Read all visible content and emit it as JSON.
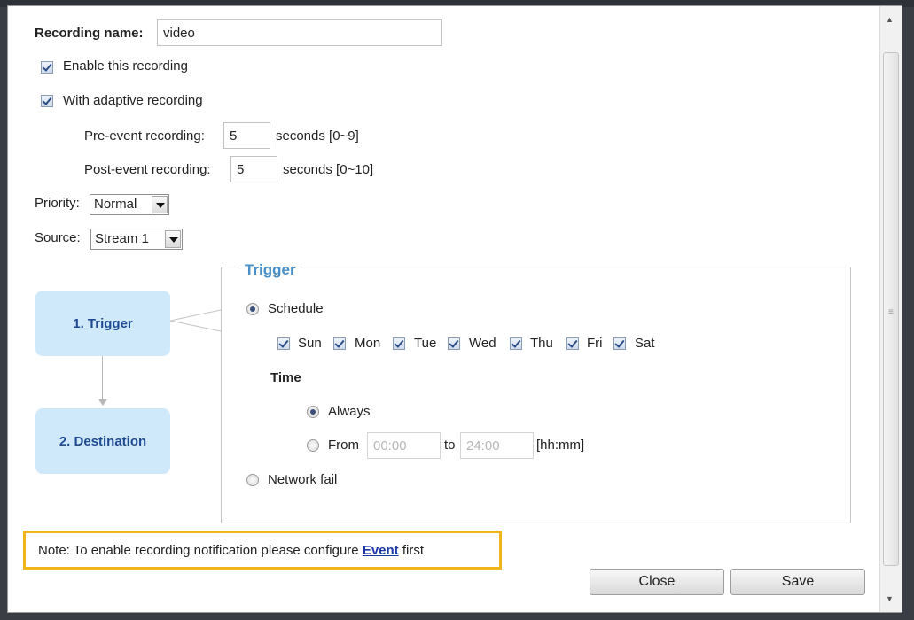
{
  "recording": {
    "name_label": "Recording name:",
    "name_value": "video",
    "enable_label": "Enable this recording",
    "adaptive_label": "With adaptive recording",
    "pre_event_label": "Pre-event recording:",
    "pre_event_value": "5",
    "pre_event_unit": "seconds [0~9]",
    "post_event_label": "Post-event recording:",
    "post_event_value": "5",
    "post_event_unit": "seconds [0~10]",
    "priority_label": "Priority:",
    "priority_value": "Normal",
    "source_label": "Source:",
    "source_value": "Stream 1"
  },
  "steps": {
    "trigger": "1. Trigger",
    "destination": "2. Destination"
  },
  "trigger": {
    "legend": "Trigger",
    "schedule_label": "Schedule",
    "days": [
      "Sun",
      "Mon",
      "Tue",
      "Wed",
      "Thu",
      "Fri",
      "Sat"
    ],
    "time_heading": "Time",
    "always_label": "Always",
    "from_label": "From",
    "from_value": "00:00",
    "to_label": "to",
    "to_value": "24:00",
    "time_format": "[hh:mm]",
    "network_fail_label": "Network fail"
  },
  "note": {
    "prefix": "Note: To enable recording notification please configure",
    "link": "Event",
    "suffix": "first"
  },
  "buttons": {
    "close": "Close",
    "save": "Save"
  },
  "colors": {
    "step_box": "#cfe9fb",
    "step_text": "#1f4a93",
    "legend": "#4a90c8",
    "note_border": "#f0b51a",
    "link": "#1a37a8"
  },
  "icons": {
    "checkbox": "checkmark",
    "radio": "radio-dot",
    "dropdown": "triangle-down",
    "scroll_up": "triangle-up",
    "scroll_down": "triangle-down",
    "scroll_grip": "grip-lines"
  }
}
